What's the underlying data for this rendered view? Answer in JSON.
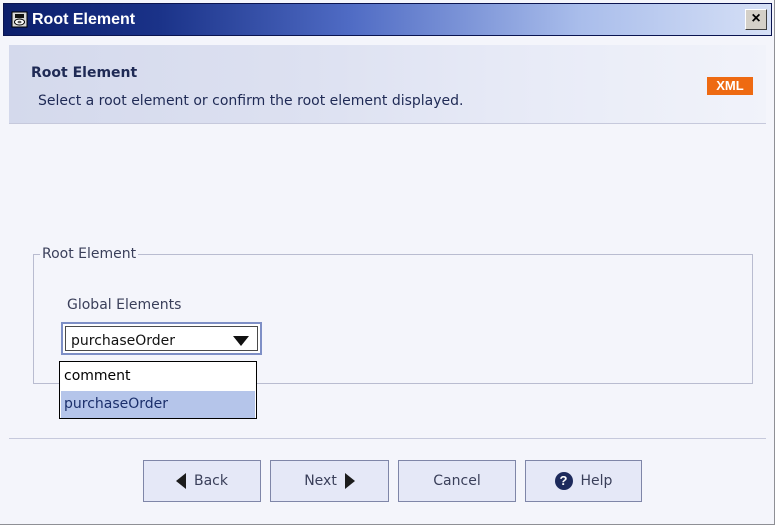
{
  "window": {
    "title": "Root Element",
    "close_label": "×"
  },
  "header": {
    "title": "Root Element",
    "description": "Select a root element or confirm the root element displayed.",
    "badge": "XML"
  },
  "group": {
    "legend": "Root Element",
    "field_label": "Global Elements",
    "select": {
      "value": "purchaseOrder",
      "options": [
        "comment",
        "purchaseOrder"
      ],
      "selected_index": 1
    }
  },
  "buttons": {
    "back": "Back",
    "next": "Next",
    "cancel": "Cancel",
    "help": "Help"
  },
  "icons": {
    "title": "app-icon",
    "back": "triangle-left-icon",
    "next": "triangle-right-icon",
    "help": "question-circle-icon",
    "dropdown": "triangle-down-icon"
  },
  "colors": {
    "badge": "#ee6a12",
    "title_bar_start": "#0b1e6b",
    "selection": "#b5c5ea"
  }
}
